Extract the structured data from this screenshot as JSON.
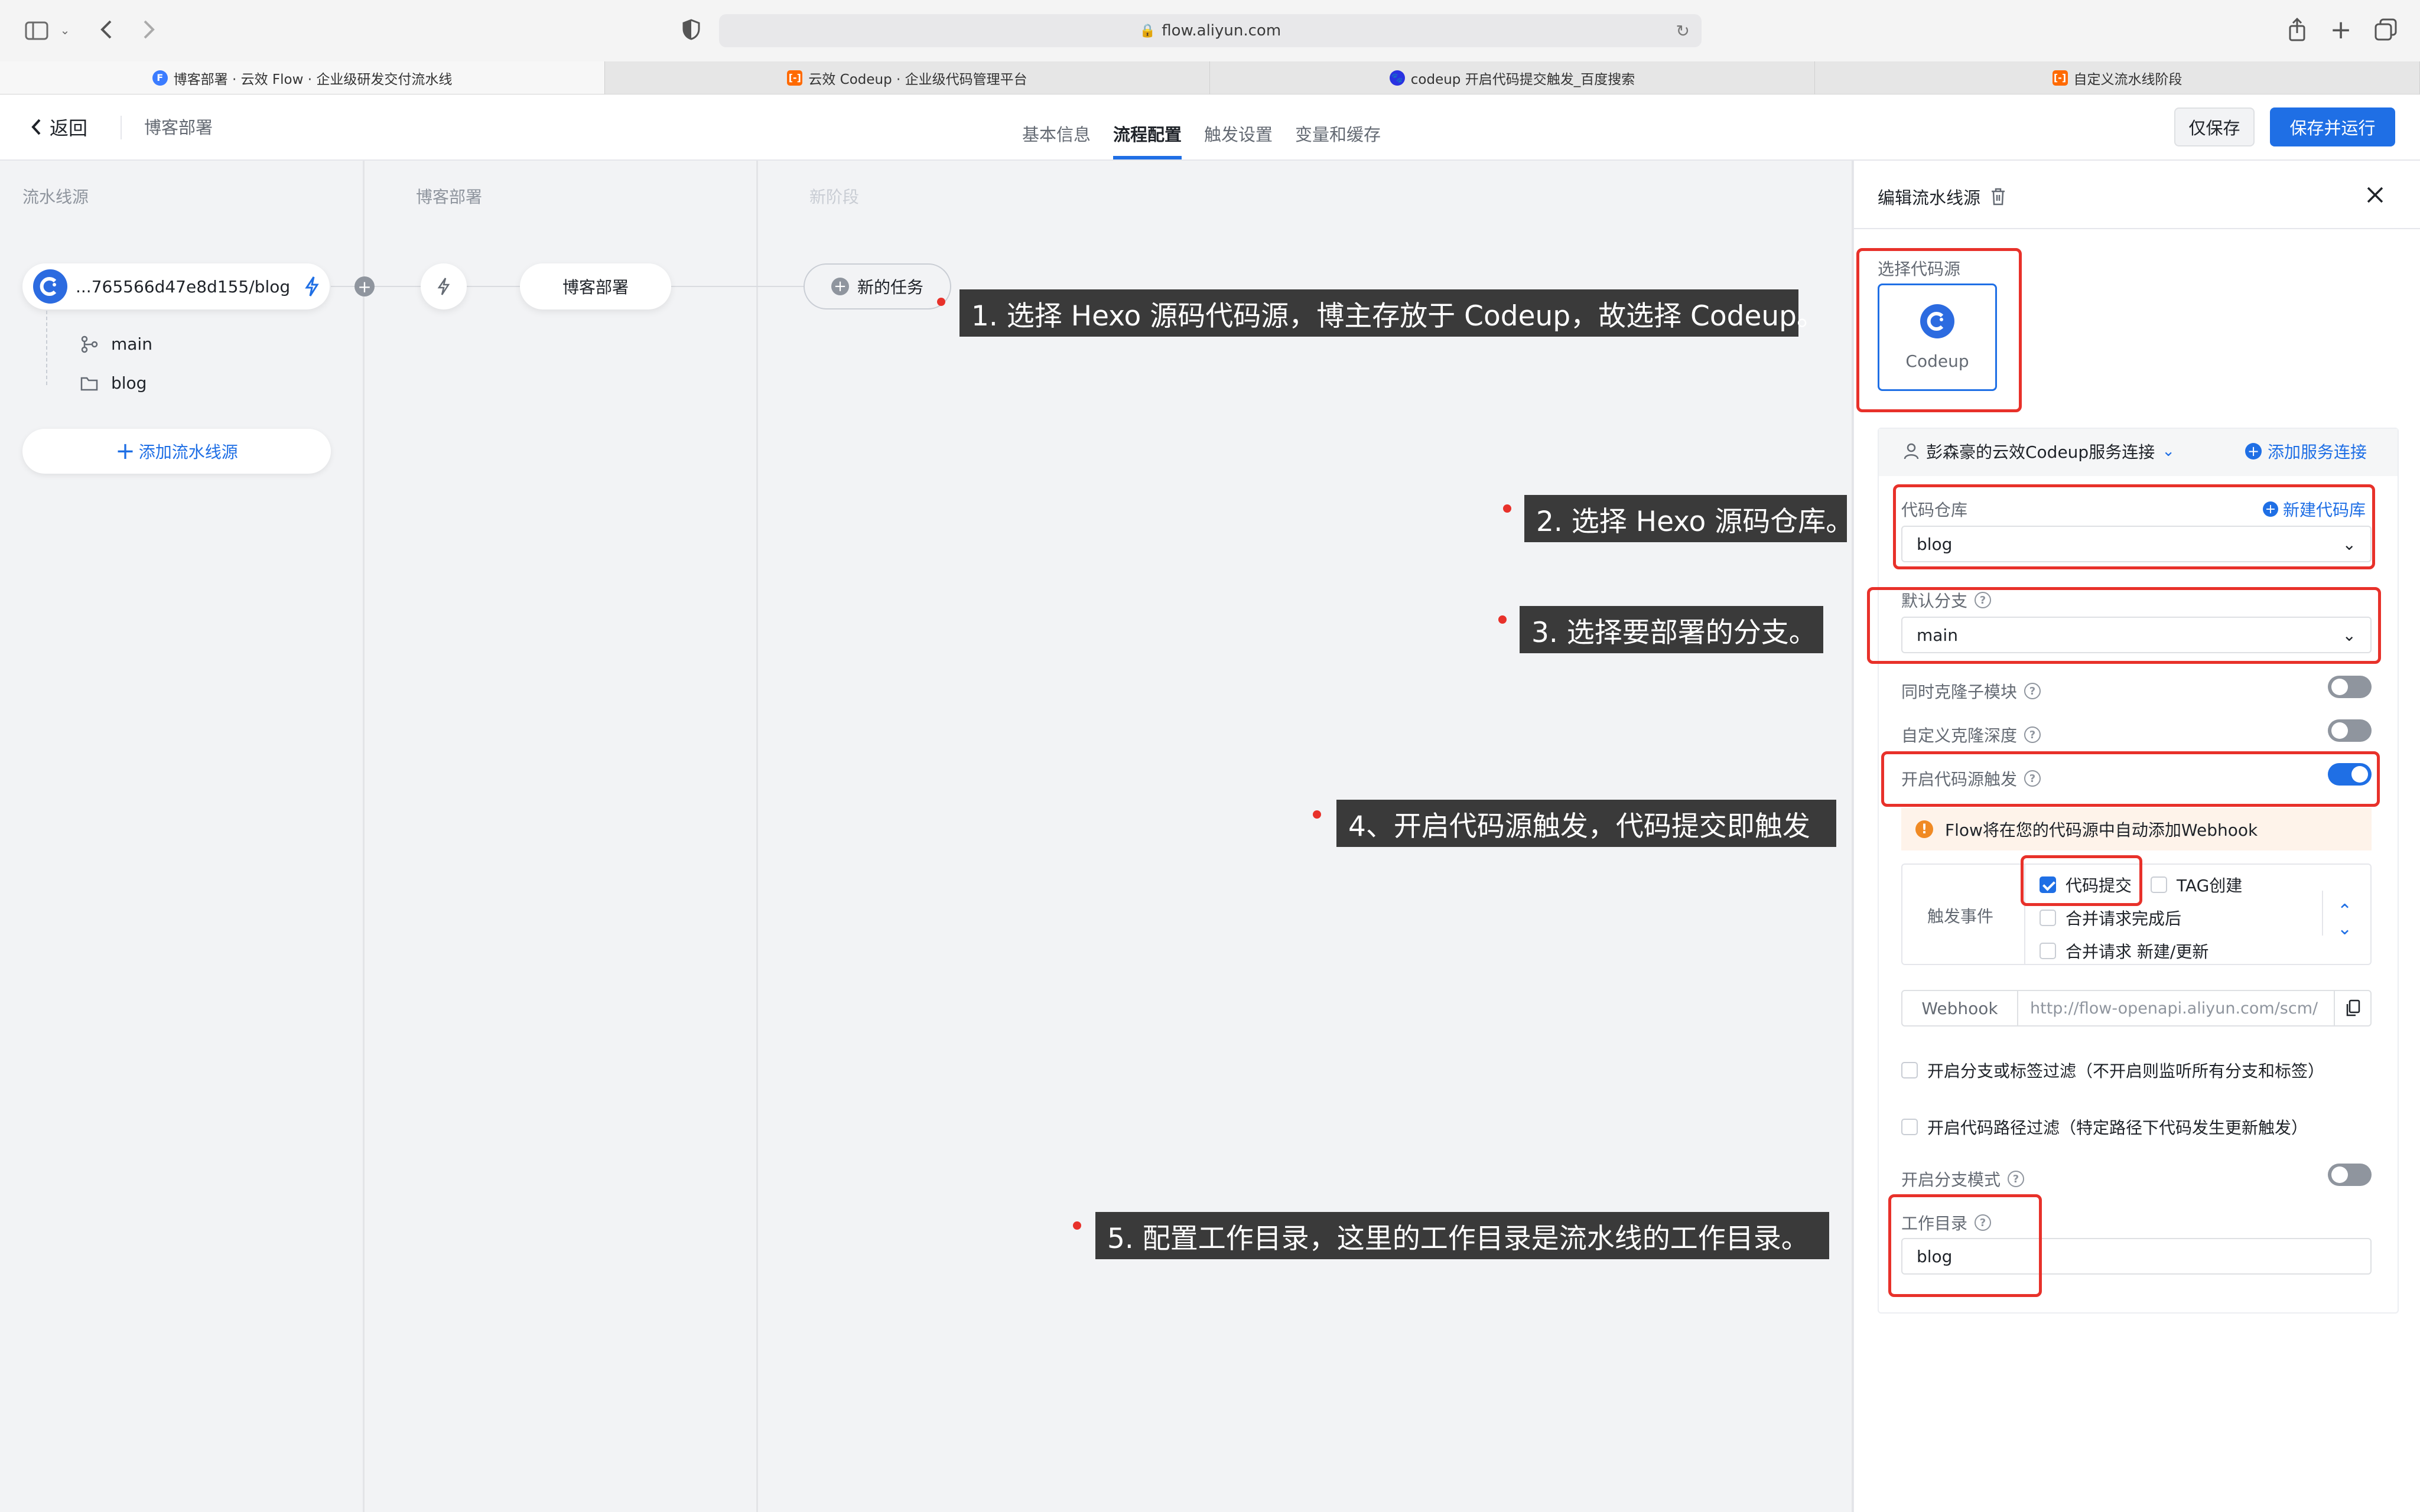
{
  "browser": {
    "url": "flow.aliyun.com",
    "tabs": [
      {
        "title": "博客部署 · 云效 Flow · 企业级研发交付流水线",
        "favicon": "flow-icon",
        "color": "#3b7cff"
      },
      {
        "title": "云效 Codeup · 企业级代码管理平台",
        "favicon": "codeup-icon",
        "color": "#ff6a00"
      },
      {
        "title": "codeup 开启代码提交触发_百度搜索",
        "favicon": "baidu-icon",
        "color": "#2932e1"
      },
      {
        "title": "自定义流水线阶段",
        "favicon": "codeup-icon",
        "color": "#ff6a00"
      }
    ]
  },
  "header": {
    "back_label": "返回",
    "pipeline_name": "博客部署",
    "nav_tabs": [
      "基本信息",
      "流程配置",
      "触发设置",
      "变量和缓存"
    ],
    "active_tab": "流程配置",
    "save_only": "仅保存",
    "save_run": "保存并运行"
  },
  "canvas": {
    "col_source": "流水线源",
    "col_stage": "博客部署",
    "col_new": "新阶段",
    "source_repo": "...765566d47e8d155/blog",
    "branch": "main",
    "workdir": "blog",
    "add_source": "添加流水线源",
    "stage_task": "博客部署",
    "new_task": "新的任务"
  },
  "callouts": {
    "c1": "1. 选择 Hexo 源码代码源，博主存放于 Codeup，故选择 Codeup。",
    "c2": "2. 选择 Hexo 源码仓库。",
    "c3": "3. 选择要部署的分支。",
    "c4": "4、开启代码源触发，代码提交即触发",
    "c5": "5. 配置工作目录，这里的工作目录是流水线的工作目录。"
  },
  "panel": {
    "title": "编辑流水线源",
    "choose_source_label": "选择代码源",
    "source_option": "Codeup",
    "service_connection": "彭森豪的云效Codeup服务连接",
    "add_service": "添加服务连接",
    "repo_label": "代码仓库",
    "new_repo": "新建代码库",
    "repo_value": "blog",
    "branch_label": "默认分支",
    "branch_value": "main",
    "clone_submodule": "同时克隆子模块",
    "clone_depth": "自定义克隆深度",
    "trigger_label": "开启代码源触发",
    "webhook_notice": "Flow将在您的代码源中自动添加Webhook",
    "events_label": "触发事件",
    "event_commit": "代码提交",
    "event_tag": "TAG创建",
    "event_merge_done": "合并请求完成后",
    "event_merge_new": "合并请求 新建/更新",
    "webhook_label": "Webhook",
    "webhook_url": "http://flow-openapi.aliyun.com/scm/",
    "branch_filter": "开启分支或标签过滤（不开启则监听所有分支和标签）",
    "path_filter": "开启代码路径过滤（特定路径下代码发生更新触发）",
    "branch_mode": "开启分支模式",
    "workdir_label": "工作目录",
    "workdir_value": "blog"
  },
  "state": {
    "clone_submodule": false,
    "clone_depth": false,
    "code_trigger": true,
    "branch_mode": false,
    "event_commit": true,
    "event_tag": false,
    "event_merge_done": false,
    "event_merge_new": false,
    "branch_filter": false,
    "path_filter": false
  },
  "colors": {
    "accent": "#1f6fe5",
    "annotation_red": "#e8312a",
    "callout_bg": "#3a3a3a"
  }
}
